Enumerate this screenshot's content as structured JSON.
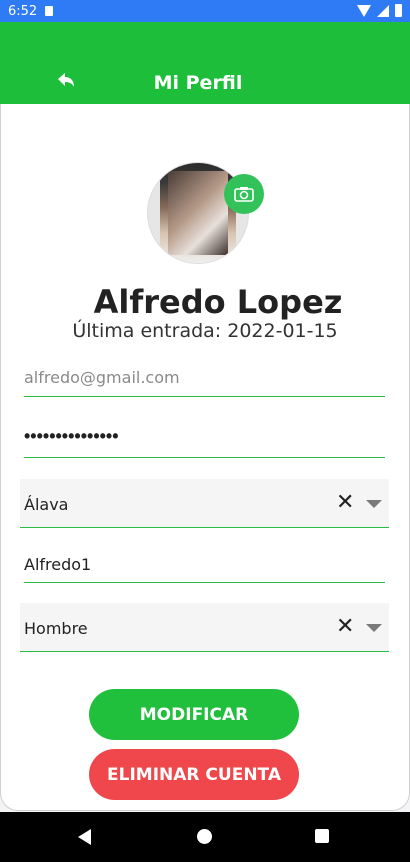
{
  "status_bar": {
    "time": "6:52",
    "icons": [
      "sd-card-icon",
      "wifi-icon",
      "signal-icon",
      "battery-icon"
    ]
  },
  "app_bar": {
    "title": "Mi Perfil",
    "back_icon": "back-arrow-icon",
    "background_color": "#1dbf3a"
  },
  "profile": {
    "name": "Alfredo Lopez",
    "last_entry": "Última entrada: 2022-01-15",
    "camera_icon": "camera-icon"
  },
  "form": {
    "email_value": "alfredo@gmail.com",
    "password_value": "•••••••••••••••",
    "province_value": "Álava",
    "nickname_value": "Alfredo1",
    "gender_value": "Hombre",
    "clear_symbol": "✕"
  },
  "actions": {
    "modify_label": "MODIFICAR",
    "delete_label": "ELIMINAR CUENTA",
    "modify_color": "#20c03c",
    "delete_color": "#f0474c"
  },
  "nav_bar": {
    "icons": [
      "nav-back-icon",
      "nav-home-icon",
      "nav-recents-icon"
    ]
  }
}
